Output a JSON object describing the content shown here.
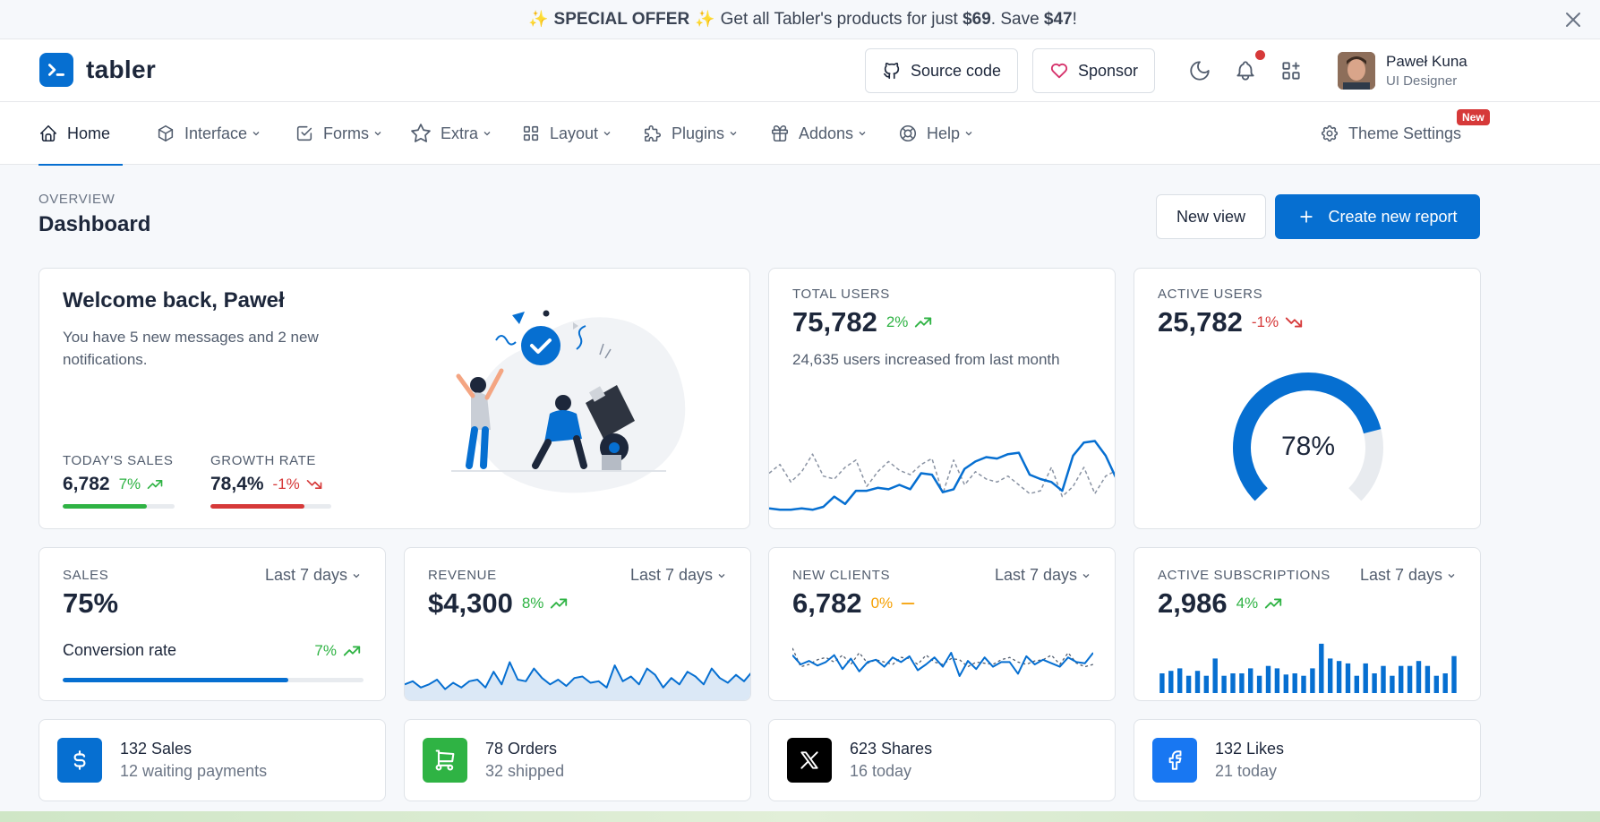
{
  "promo": {
    "label": "SPECIAL OFFER",
    "text_before": " Get all Tabler's products for just ",
    "price": "$69",
    "text_mid": ". Save ",
    "save": "$47",
    "text_end": "!"
  },
  "header": {
    "brand": "tabler",
    "source_code": "Source code",
    "sponsor": "Sponsor",
    "user_name": "Paweł Kuna",
    "user_role": "UI Designer"
  },
  "nav": {
    "items": [
      {
        "label": "Home"
      },
      {
        "label": "Interface"
      },
      {
        "label": "Forms"
      },
      {
        "label": "Extra"
      },
      {
        "label": "Layout"
      },
      {
        "label": "Plugins"
      },
      {
        "label": "Addons"
      },
      {
        "label": "Help"
      }
    ],
    "theme_settings": "Theme Settings",
    "new_badge": "New"
  },
  "page": {
    "pretitle": "OVERVIEW",
    "title": "Dashboard",
    "new_view": "New view",
    "create_report": "Create new report"
  },
  "welcome": {
    "title": "Welcome back, Paweł",
    "text": "You have 5 new messages and 2 new notifications.",
    "sales_label": "TODAY'S SALES",
    "sales_value": "6,782",
    "sales_trend": "7%",
    "sales_progress": 0.75,
    "growth_label": "GROWTH RATE",
    "growth_value": "78,4%",
    "growth_trend": "-1%",
    "growth_progress": 0.78
  },
  "total_users": {
    "label": "TOTAL USERS",
    "value": "75,782",
    "trend": "2%",
    "subtitle": "24,635 users increased from last month"
  },
  "active_users": {
    "label": "ACTIVE USERS",
    "value": "25,782",
    "trend": "-1%",
    "gauge_percent": 78,
    "gauge_label": "78%"
  },
  "sales": {
    "label": "SALES",
    "period": "Last 7 days",
    "value": "75%",
    "conversion_label": "Conversion rate",
    "conversion_trend": "7%",
    "conversion_progress": 0.75
  },
  "revenue": {
    "label": "REVENUE",
    "period": "Last 7 days",
    "value": "$4,300",
    "trend": "8%"
  },
  "new_clients": {
    "label": "NEW CLIENTS",
    "period": "Last 7 days",
    "value": "6,782",
    "trend": "0%"
  },
  "active_subscriptions": {
    "label": "ACTIVE SUBSCRIPTIONS",
    "period": "Last 7 days",
    "value": "2,986",
    "trend": "4%"
  },
  "info_cards": [
    {
      "title": "132 Sales",
      "subtitle": "12 waiting payments"
    },
    {
      "title": "78 Orders",
      "subtitle": "32 shipped"
    },
    {
      "title": "623 Shares",
      "subtitle": "16 today"
    },
    {
      "title": "132 Likes",
      "subtitle": "21 today"
    }
  ],
  "colors": {
    "primary": "#066fd1",
    "success": "#2fb344",
    "danger": "#d63939",
    "warning": "#f59f00",
    "x_brand": "#000000",
    "facebook": "#1877f2"
  },
  "chart_data": [
    {
      "type": "line",
      "name": "total-users-sparkline",
      "series": [
        {
          "values": [
            10,
            9,
            9,
            10,
            9,
            11,
            18,
            13,
            22,
            22,
            24,
            23,
            26,
            23,
            34,
            33,
            21,
            23,
            37,
            42,
            45,
            44,
            47,
            48,
            33,
            30,
            28,
            22,
            46,
            55,
            56,
            46,
            30
          ]
        },
        {
          "values": [
            34,
            40,
            28,
            35,
            47,
            32,
            30,
            38,
            43,
            25,
            35,
            42,
            36,
            33,
            40,
            44,
            20,
            43,
            26,
            35,
            30,
            28,
            32,
            26,
            20,
            22,
            38,
            18,
            25,
            38,
            20,
            32,
            36
          ]
        }
      ]
    },
    {
      "type": "line",
      "name": "revenue-sparkline",
      "series": [
        {
          "values": [
            10,
            12,
            8,
            10,
            13,
            7,
            11,
            8,
            12,
            13,
            8,
            18,
            10,
            24,
            13,
            12,
            20,
            14,
            10,
            13,
            9,
            14,
            15,
            11,
            12,
            8,
            22,
            12,
            15,
            10,
            20,
            16,
            8,
            14,
            10,
            18,
            15,
            10,
            20,
            14,
            11,
            16,
            12,
            18
          ]
        }
      ]
    },
    {
      "type": "line",
      "name": "new-clients-sparkline",
      "series": [
        {
          "values": [
            28,
            20,
            23,
            19,
            22,
            28,
            16,
            25,
            14,
            22,
            24,
            18,
            26,
            22,
            27,
            15,
            20,
            26,
            18,
            30,
            10,
            23,
            16,
            26,
            18,
            22,
            22,
            12,
            27,
            20,
            24,
            21,
            18,
            26,
            22,
            21,
            30
          ]
        },
        {
          "values": [
            34,
            18,
            20,
            24,
            26,
            22,
            28,
            20,
            30,
            21,
            24,
            22,
            20,
            26,
            25,
            20,
            28,
            22,
            20,
            25,
            24,
            18,
            22,
            21,
            20,
            24,
            26,
            22,
            20,
            23,
            24,
            28,
            20,
            30,
            21,
            18,
            20
          ]
        }
      ]
    },
    {
      "type": "bar",
      "name": "active-subscriptions-bars",
      "values": [
        16,
        18,
        20,
        14,
        18,
        14,
        28,
        14,
        16,
        16,
        20,
        14,
        22,
        20,
        15,
        16,
        14,
        20,
        40,
        28,
        26,
        24,
        14,
        24,
        16,
        22,
        14,
        22,
        22,
        26,
        22,
        14,
        16,
        30
      ]
    }
  ]
}
